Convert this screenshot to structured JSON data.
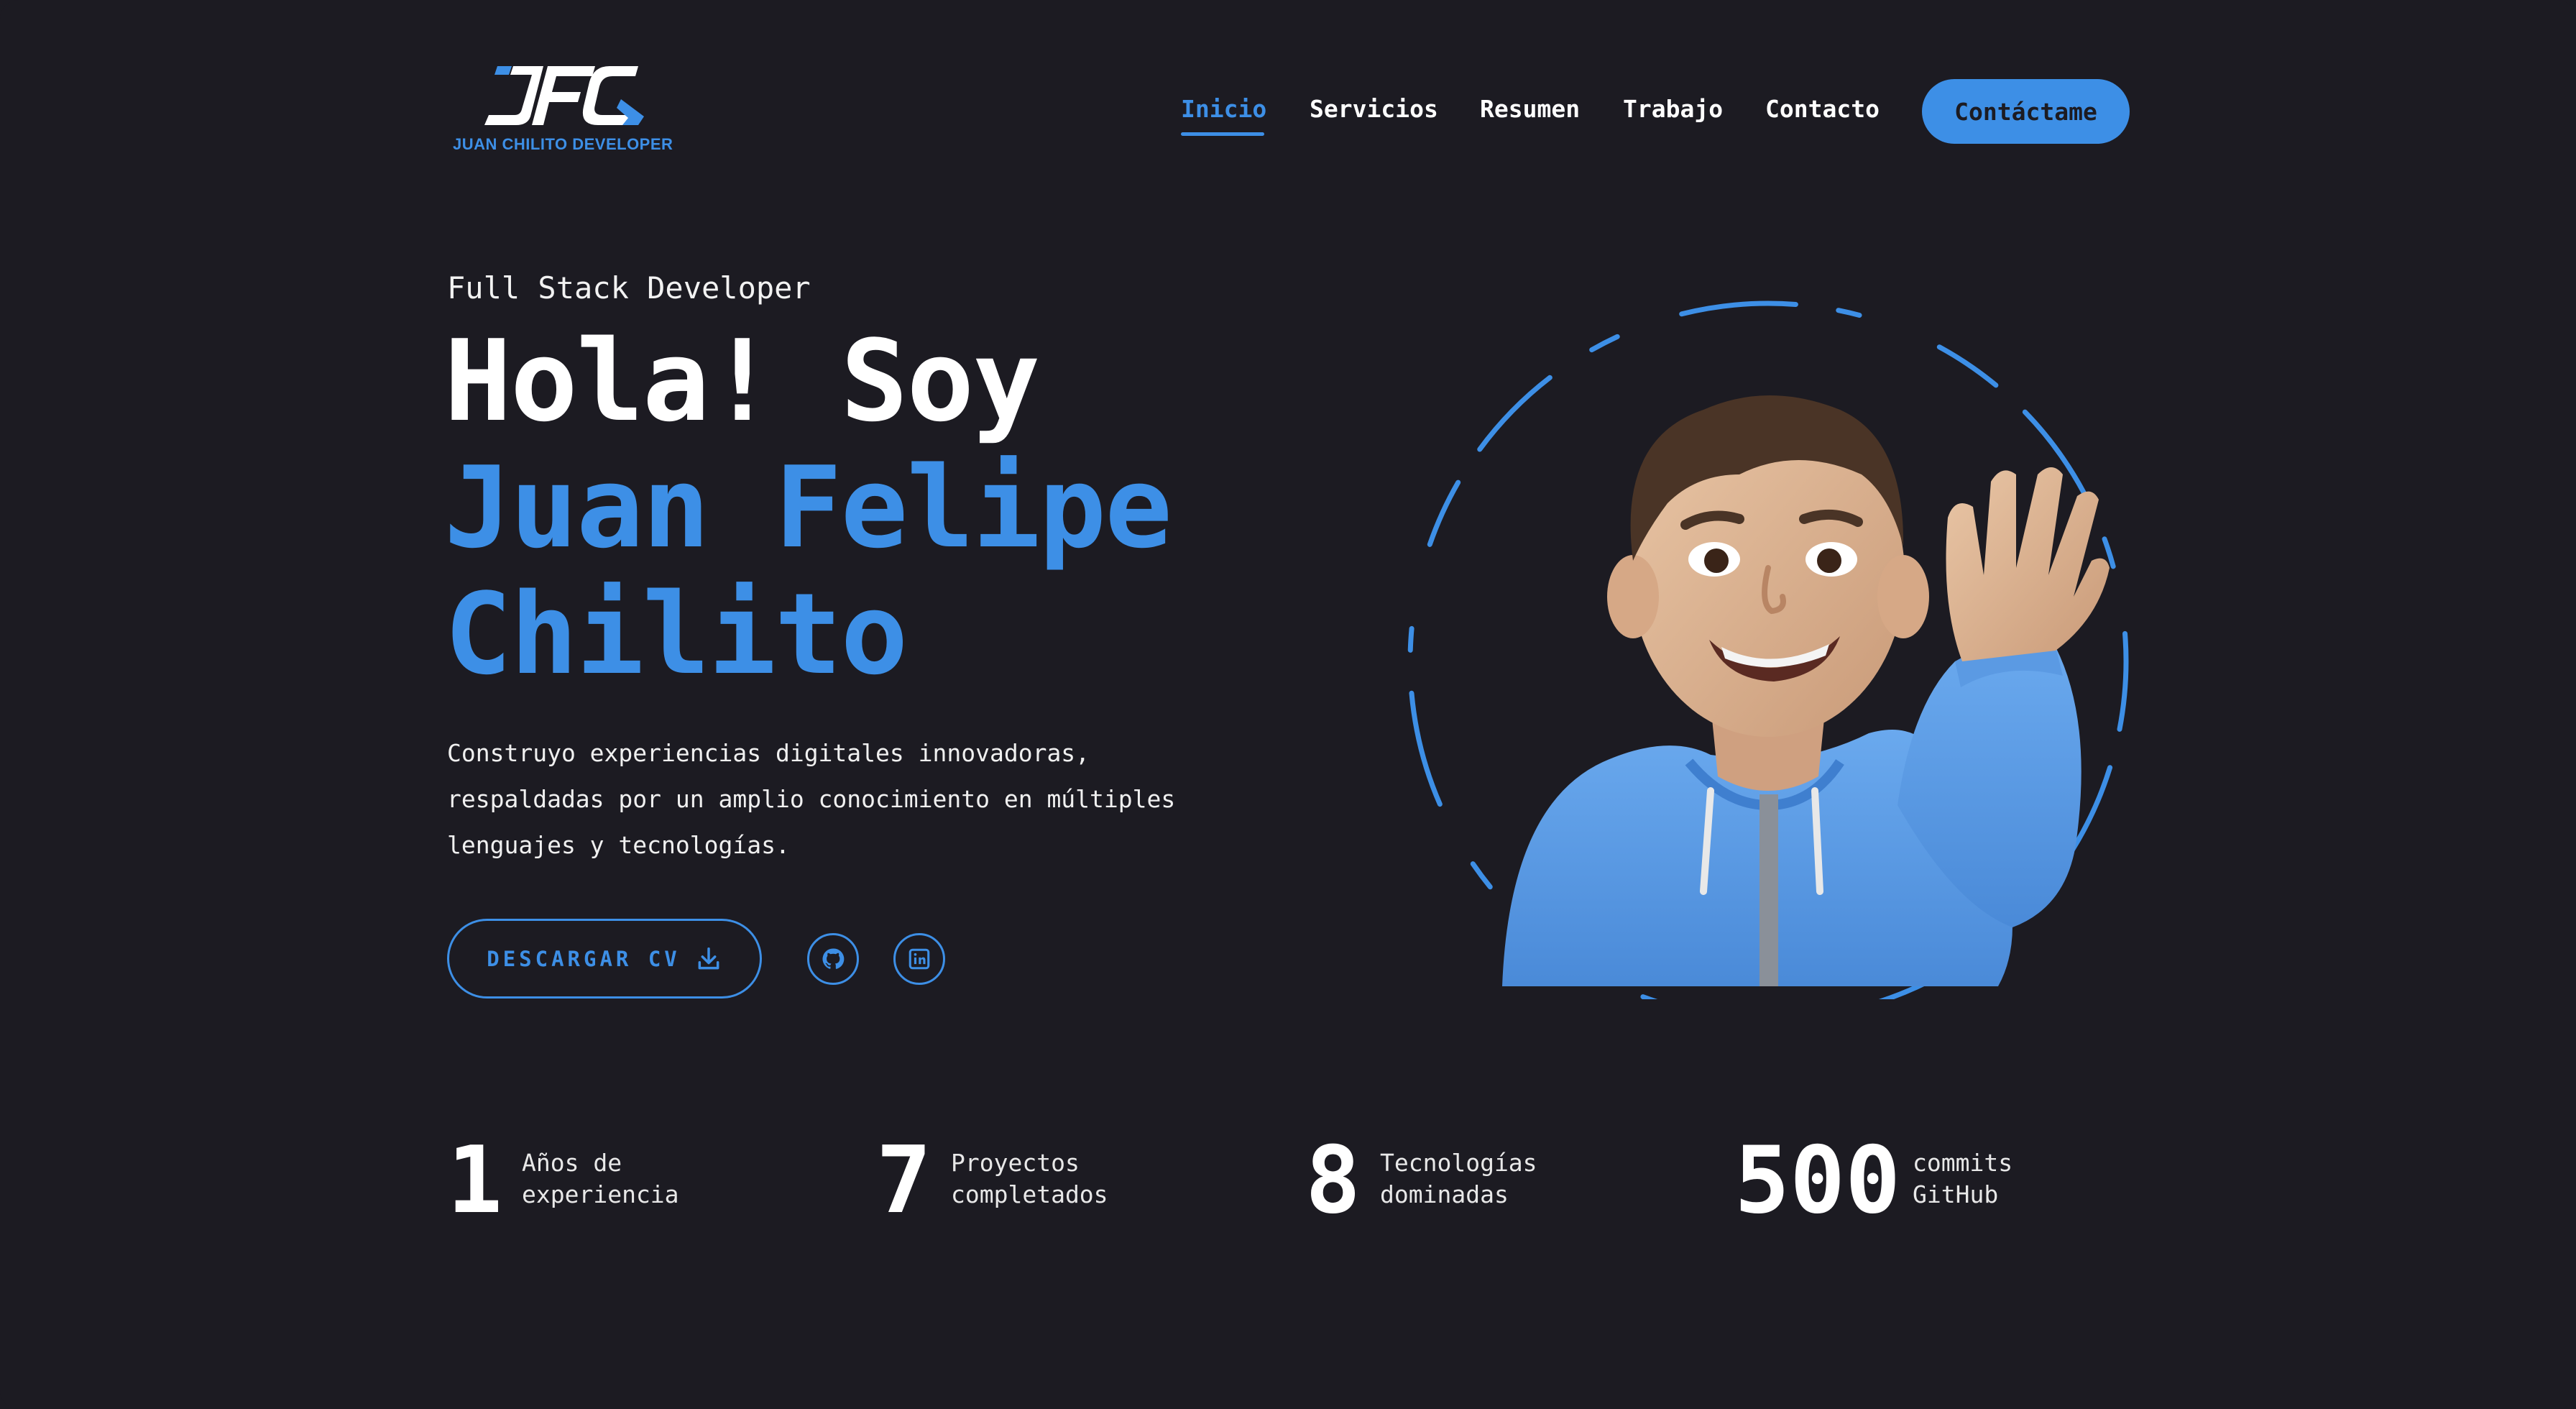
{
  "colors": {
    "background": "#1c1b22",
    "accent": "#3d8fe6",
    "text": "#ffffff"
  },
  "logo": {
    "mark": "JFC",
    "subtitle": "JUAN CHILITO DEVELOPER"
  },
  "nav": {
    "items": [
      {
        "label": "Inicio",
        "active": true
      },
      {
        "label": "Servicios",
        "active": false
      },
      {
        "label": "Resumen",
        "active": false
      },
      {
        "label": "Trabajo",
        "active": false
      },
      {
        "label": "Contacto",
        "active": false
      }
    ],
    "cta_label": "Contáctame"
  },
  "hero": {
    "role": "Full Stack Developer",
    "greeting": "Hola! Soy",
    "name_line1": "Juan Felipe",
    "name_line2": "Chilito",
    "description_lines": [
      "Construyo experiencias digitales innovadoras,",
      "respaldadas por un amplio conocimiento en múltiples",
      "lenguajes y tecnologías."
    ],
    "cv_button_label": "DESCARGAR CV",
    "icons": [
      "download-icon",
      "github-icon",
      "linkedin-icon"
    ]
  },
  "stats": [
    {
      "value": "1",
      "label_line1": "Años de",
      "label_line2": "experiencia"
    },
    {
      "value": "7",
      "label_line1": "Proyectos",
      "label_line2": "completados"
    },
    {
      "value": "8",
      "label_line1": "Tecnologías",
      "label_line2": "dominadas"
    },
    {
      "value": "500",
      "label_line1": "commits",
      "label_line2": "GitHub"
    }
  ]
}
